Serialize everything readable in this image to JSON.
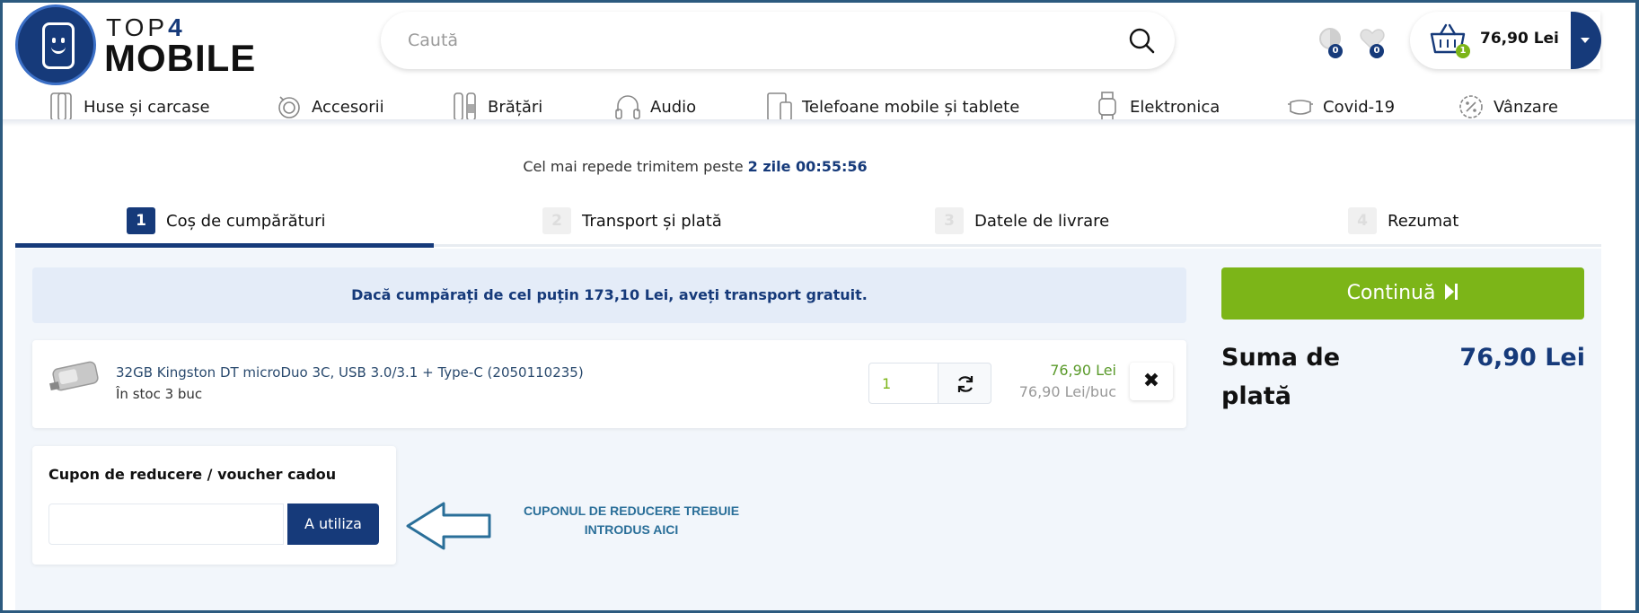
{
  "header": {
    "logo_top": "TOP",
    "logo_four": "4",
    "logo_bottom": "MOBILE",
    "search_placeholder": "Caută",
    "compare_count": "0",
    "wishlist_count": "0",
    "cart_count": "1",
    "cart_total": "76,90 Lei"
  },
  "nav": [
    {
      "label": "Huse și carcase",
      "icon": "phone-case-icon"
    },
    {
      "label": "Accesorii",
      "icon": "cable-icon"
    },
    {
      "label": "Brățări",
      "icon": "band-icon"
    },
    {
      "label": "Audio",
      "icon": "headphones-icon"
    },
    {
      "label": "Telefoane mobile și tablete",
      "icon": "tablet-phone-icon"
    },
    {
      "label": "Elektronica",
      "icon": "smartwatch-icon"
    },
    {
      "label": "Covid-19",
      "icon": "mask-icon"
    },
    {
      "label": "Vânzare",
      "icon": "discount-icon"
    }
  ],
  "delivery": {
    "text": "Cel mai repede trimitem peste",
    "time": "2 zile 00:55:56"
  },
  "steps": [
    {
      "num": "1",
      "label": "Coș de cumpărături",
      "active": true
    },
    {
      "num": "2",
      "label": "Transport și plată",
      "active": false
    },
    {
      "num": "3",
      "label": "Datele de livrare",
      "active": false
    },
    {
      "num": "4",
      "label": "Rezumat",
      "active": false
    }
  ],
  "notice": "Dacă cumpărați de cel puțin 173,10 Lei, aveți transport gratuit.",
  "item": {
    "name": "32GB Kingston DT microDuo 3C, USB 3.0/3.1 + Type-C (2050110235)",
    "stock": "În stoc 3 buc",
    "quantity": "1",
    "price": "76,90 Lei",
    "unit_price": "76,90 Lei/buc"
  },
  "coupon": {
    "title": "Cupon de reducere / voucher cadou",
    "button": "A utiliza",
    "value": ""
  },
  "annotation": {
    "line1": "CUPONUL DE REDUCERE TREBUIE",
    "line2": "INTRODUS AICI"
  },
  "summary": {
    "continue_label": "Continuă",
    "sum_label": "Suma de plată",
    "sum_value": "76,90 Lei"
  },
  "colors": {
    "brand": "#163a7a",
    "accent_green": "#7cb518",
    "annotation": "#2a6f99"
  }
}
